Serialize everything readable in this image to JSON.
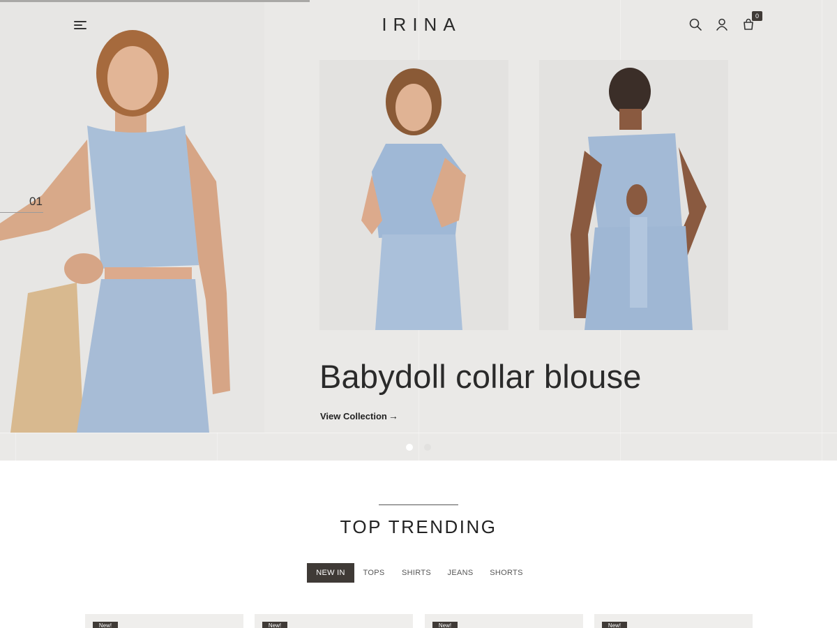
{
  "header": {
    "logo": "IRINA",
    "cart_count": "0",
    "icons": [
      "menu-icon",
      "search-icon",
      "user-icon",
      "cart-icon"
    ]
  },
  "hero": {
    "slide_number": "01",
    "progress": 0.37,
    "title": "Babydoll collar blouse",
    "link_label": "View Collection",
    "link_arrow": "→",
    "slides_total": 2,
    "active_slide": 1
  },
  "trending": {
    "title": "TOP TRENDING",
    "tabs": [
      {
        "label": "NEW IN",
        "active": true
      },
      {
        "label": "TOPS",
        "active": false
      },
      {
        "label": "SHIRTS",
        "active": false
      },
      {
        "label": "JEANS",
        "active": false
      },
      {
        "label": "SHORTS",
        "active": false
      }
    ],
    "cards": [
      {
        "badge": "New!"
      },
      {
        "badge": "New!"
      },
      {
        "badge": "New!"
      },
      {
        "badge": "New!"
      }
    ]
  },
  "colors": {
    "accent": "#3f3a36",
    "hero_bg": "#eae9e7",
    "denim": "#a9bfd8"
  }
}
